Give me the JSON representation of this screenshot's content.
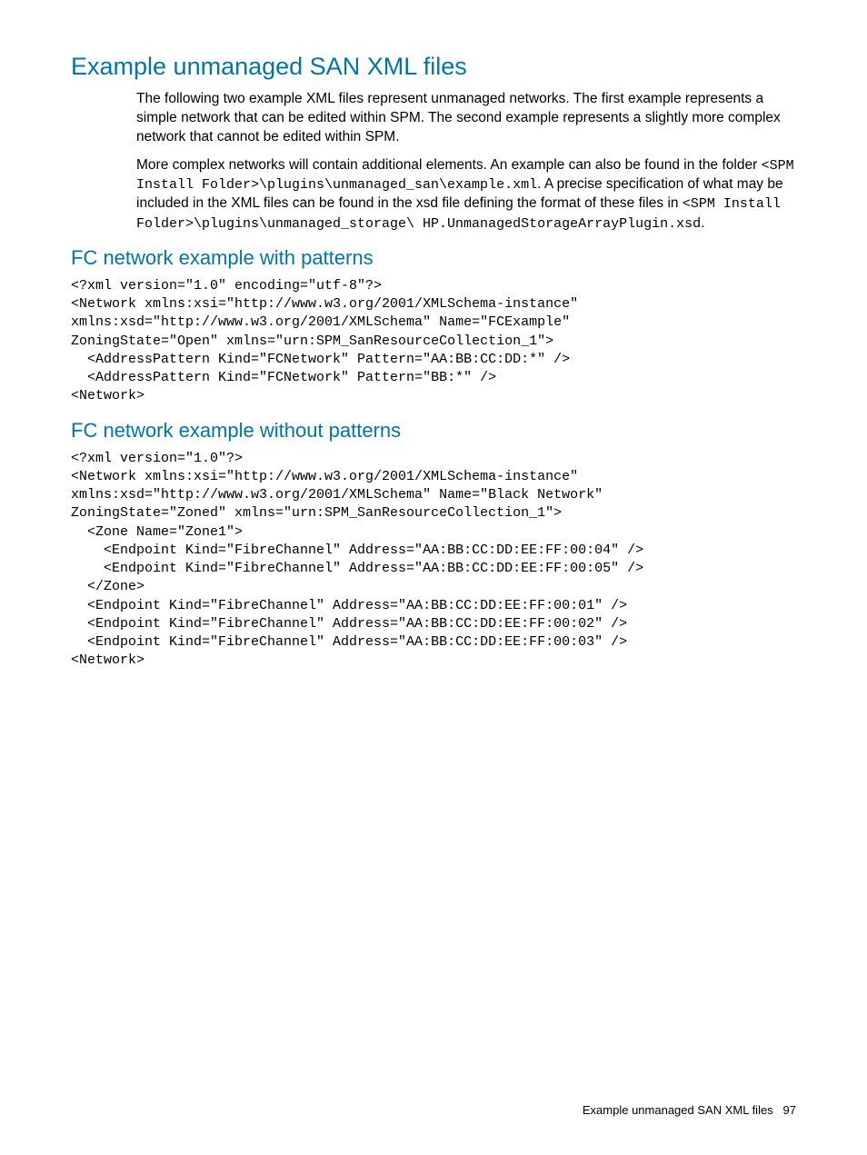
{
  "heading": "Example unmanaged SAN XML files",
  "para1": "The following two example XML files represent unmanaged networks. The first example represents a simple network that can be edited within SPM. The second example represents a slightly more complex network that cannot be edited within SPM.",
  "para2_a": "More complex networks will contain additional elements. An example can also be found in the folder ",
  "para2_code1": "<SPM Install Folder>\\plugins\\unmanaged_san\\example.xml",
  "para2_b": ". A precise specification of what may be included in the XML files can be found in the xsd file defining the format of these files in ",
  "para2_code2": "<SPM Install Folder>\\plugins\\unmanaged_storage\\ HP.UnmanagedStorageArrayPlugin.xsd",
  "para2_c": ".",
  "sub1": "FC network example with patterns",
  "code1": "<?xml version=\"1.0\" encoding=\"utf-8\"?>\n<Network xmlns:xsi=\"http://www.w3.org/2001/XMLSchema-instance\"\nxmlns:xsd=\"http://www.w3.org/2001/XMLSchema\" Name=\"FCExample\"\nZoningState=\"Open\" xmlns=\"urn:SPM_SanResourceCollection_1\">\n  <AddressPattern Kind=\"FCNetwork\" Pattern=\"AA:BB:CC:DD:*\" />\n  <AddressPattern Kind=\"FCNetwork\" Pattern=\"BB:*\" />\n<Network>",
  "sub2": "FC network example without patterns",
  "code2": "<?xml version=\"1.0\"?>\n<Network xmlns:xsi=\"http://www.w3.org/2001/XMLSchema-instance\"\nxmlns:xsd=\"http://www.w3.org/2001/XMLSchema\" Name=\"Black Network\"\nZoningState=\"Zoned\" xmlns=\"urn:SPM_SanResourceCollection_1\">\n  <Zone Name=\"Zone1\">\n    <Endpoint Kind=\"FibreChannel\" Address=\"AA:BB:CC:DD:EE:FF:00:04\" />\n    <Endpoint Kind=\"FibreChannel\" Address=\"AA:BB:CC:DD:EE:FF:00:05\" />\n  </Zone>\n  <Endpoint Kind=\"FibreChannel\" Address=\"AA:BB:CC:DD:EE:FF:00:01\" />\n  <Endpoint Kind=\"FibreChannel\" Address=\"AA:BB:CC:DD:EE:FF:00:02\" />\n  <Endpoint Kind=\"FibreChannel\" Address=\"AA:BB:CC:DD:EE:FF:00:03\" />\n<Network>",
  "footer_text": "Example unmanaged SAN XML files",
  "footer_page": "97"
}
